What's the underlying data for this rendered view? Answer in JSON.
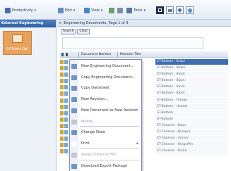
{
  "toolbar": {
    "groups": [
      {
        "label": "Productivity",
        "icon": "person-icon",
        "color": "#4a6fa5"
      },
      {
        "label": "Edit",
        "icon": "edit-icon",
        "color": "#6b8dbf"
      },
      {
        "label": "View",
        "icon": "view-icon",
        "color": "#4e80c4"
      },
      {
        "label": "Tools",
        "icon": "tools-icon",
        "color": "#58739c"
      }
    ]
  },
  "left_panel": {
    "title": "External Engineering",
    "tile_label": "EXTERNAL ENG"
  },
  "main": {
    "tab_title": "Engineering Documents, Page 1 of 3",
    "tab_close": "×",
    "search_button": "Search",
    "clear_button": "Clear",
    "columns": [
      "Document Number",
      "Revision Title"
    ]
  },
  "context_menu": {
    "items": [
      {
        "label": "New Engineering Document...",
        "disabled": false,
        "icon_color": "#6f94c6"
      },
      {
        "label": "Copy Engineering Document...",
        "disabled": false,
        "icon_color": "#6f94c6"
      },
      {
        "label": "Copy Datasheet",
        "disabled": false,
        "icon_color": "#6f94c6"
      },
      {
        "label": "New Revision...",
        "disabled": false,
        "icon_color": "#6f94c6"
      },
      {
        "label": "New Document as New Revision",
        "disabled": false,
        "icon_color": "#6f94c6"
      },
      {
        "label": "Modify",
        "disabled": true,
        "icon_color": "#c0c7d3"
      },
      {
        "label": "Change State",
        "disabled": false,
        "icon_color": "#6f94c6"
      },
      {
        "label": "Print",
        "disabled": false,
        "icon_color": "#ffffff"
      },
      {
        "label": "Assign External File",
        "disabled": true,
        "icon_color": "#c0c7d3"
      },
      {
        "label": "Download Export Package",
        "disabled": false,
        "icon_color": "#6f94c6"
      }
    ],
    "print_arrow": "▸"
  },
  "list": [
    "ST-Bottom - Bract",
    "ST-Bottom - Beam",
    "ST-Bottom - Block",
    "ST-Bottom - Block",
    "ST-Bottom - Block",
    "ST-Bottom - Block",
    "ST-Bottom - Flange",
    "ST-Bottom - Header",
    "ST-Bottom",
    "ST-Bottom",
    "ST-Channel - Basic",
    "ST-Channel - Bumper",
    "ST-Channel - Corner",
    "ST-Channel - Hinge/Pin",
    "ST-Channel - Purlin"
  ],
  "list_selected_index": 0
}
